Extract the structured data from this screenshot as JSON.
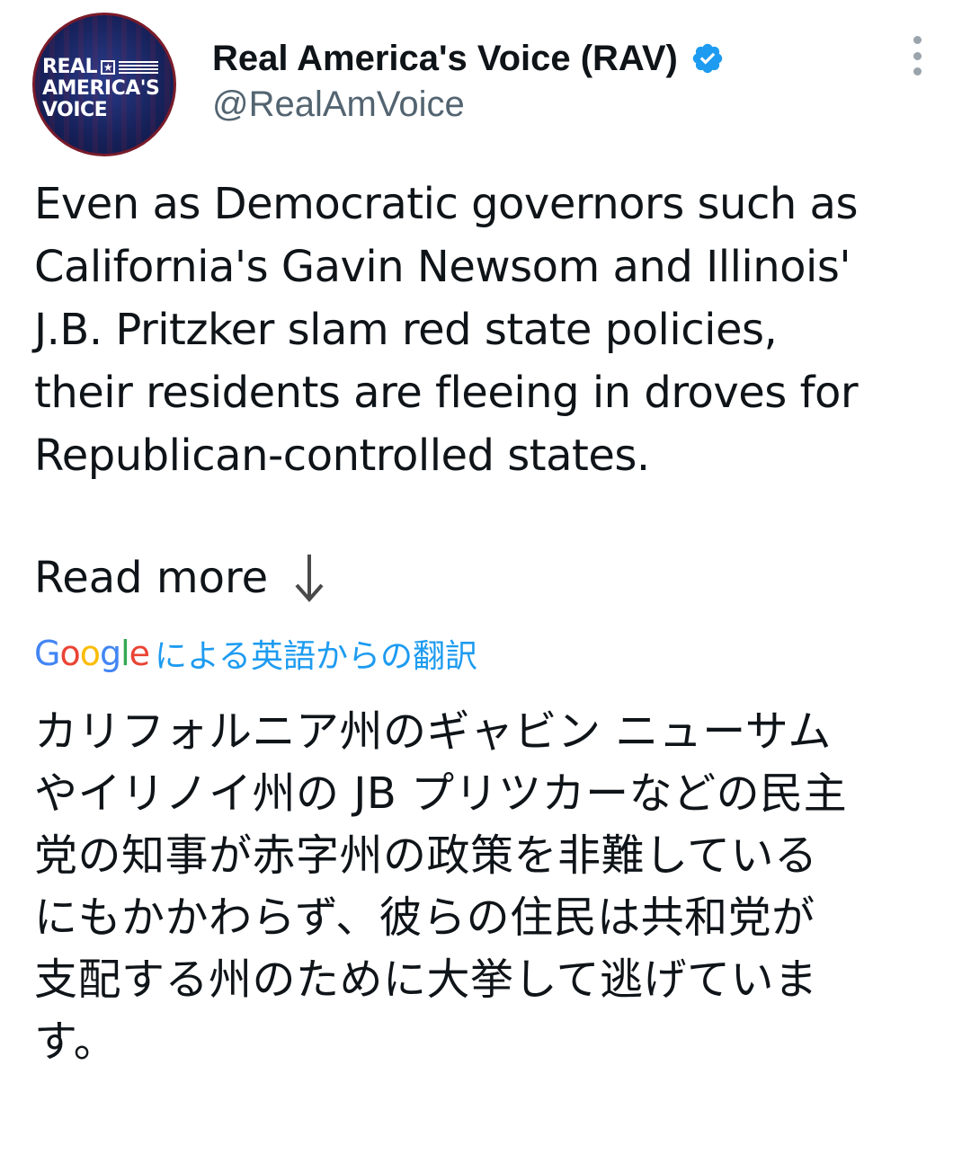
{
  "author": {
    "display_name": "Real America's Voice (RAV)",
    "handle": "@RealAmVoice",
    "avatar_logo_lines": [
      "REAL",
      "AMERICA'S",
      "VOICE"
    ],
    "verified_badge_color": "#1d9bf0"
  },
  "tweet": {
    "text_lines": [
      "Even as Democratic governors such as",
      "California's Gavin Newsom and Illinois'",
      "J.B. Pritzker slam red state policies,",
      "their residents are fleeing in droves for",
      "Republican-controlled states."
    ],
    "read_more": "Read more"
  },
  "translation": {
    "provider": "Google",
    "caption": "による英語からの翻訳",
    "text_lines": [
      "カリフォルニア州のギャビン ニューサム",
      "やイリノイ州の JB プリツカーなどの民主",
      "党の知事が赤字州の政策を非難している",
      "にもかかわらず、彼らの住民は共和党が",
      "支配する州のために大挙して逃げていま",
      "す。"
    ]
  },
  "colors": {
    "text": "#0f1419",
    "secondary": "#536471",
    "accent": "#1d9bf0"
  },
  "icons": {
    "more": "more-vertical-icon",
    "verified": "verified-badge-icon",
    "read_more_arrow": "arrow-down-icon"
  }
}
